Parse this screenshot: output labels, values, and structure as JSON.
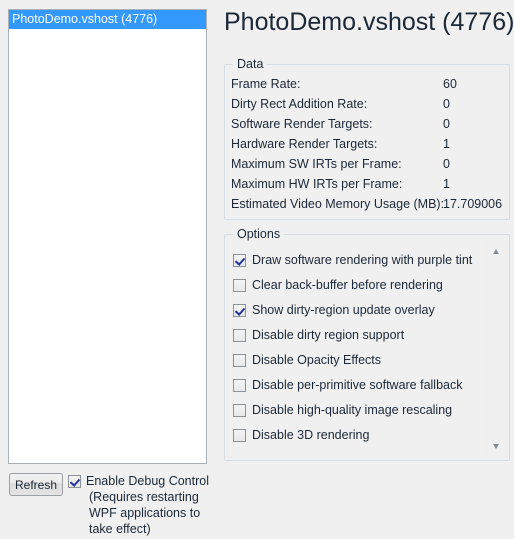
{
  "window": {
    "title": "PhotoDemo.vshost (4776)"
  },
  "process_list": {
    "items": [
      {
        "label": "PhotoDemo.vshost (4776)",
        "selected": true
      }
    ]
  },
  "toolbar": {
    "refresh_label": "Refresh",
    "enable_debug_control_label": "Enable Debug Control",
    "enable_debug_control_checked": true,
    "enable_debug_control_hint": "(Requires restarting\nWPF applications to\ntake effect)"
  },
  "data_group": {
    "title": "Data",
    "rows": [
      {
        "label": "Frame Rate:",
        "value": "60"
      },
      {
        "label": "Dirty Rect Addition Rate:",
        "value": "0"
      },
      {
        "label": "Software Render Targets:",
        "value": "0"
      },
      {
        "label": "Hardware Render Targets:",
        "value": "1"
      },
      {
        "label": "Maximum SW IRTs per Frame:",
        "value": "0"
      },
      {
        "label": "Maximum HW IRTs per Frame:",
        "value": "1"
      },
      {
        "label": "Estimated Video Memory Usage (MB):",
        "value": "17.709006",
        "wide": true
      }
    ]
  },
  "options_group": {
    "title": "Options",
    "options": [
      {
        "label": "Draw software rendering with purple tint",
        "checked": true
      },
      {
        "label": "Clear back-buffer before rendering",
        "checked": false
      },
      {
        "label": "Show dirty-region update overlay",
        "checked": true
      },
      {
        "label": "Disable dirty region support",
        "checked": false
      },
      {
        "label": "Disable Opacity Effects",
        "checked": false
      },
      {
        "label": "Disable per-primitive software fallback",
        "checked": false
      },
      {
        "label": "Disable high-quality image rescaling",
        "checked": false
      },
      {
        "label": "Disable 3D rendering",
        "checked": false
      }
    ],
    "scrollbar": {
      "up_arrow": "scroll-up-arrow",
      "down_arrow": "scroll-down-arrow"
    }
  },
  "colors": {
    "selection_blue": "#3399ff",
    "checkmark": "#21359b",
    "window_background": "#f0f0f0"
  }
}
